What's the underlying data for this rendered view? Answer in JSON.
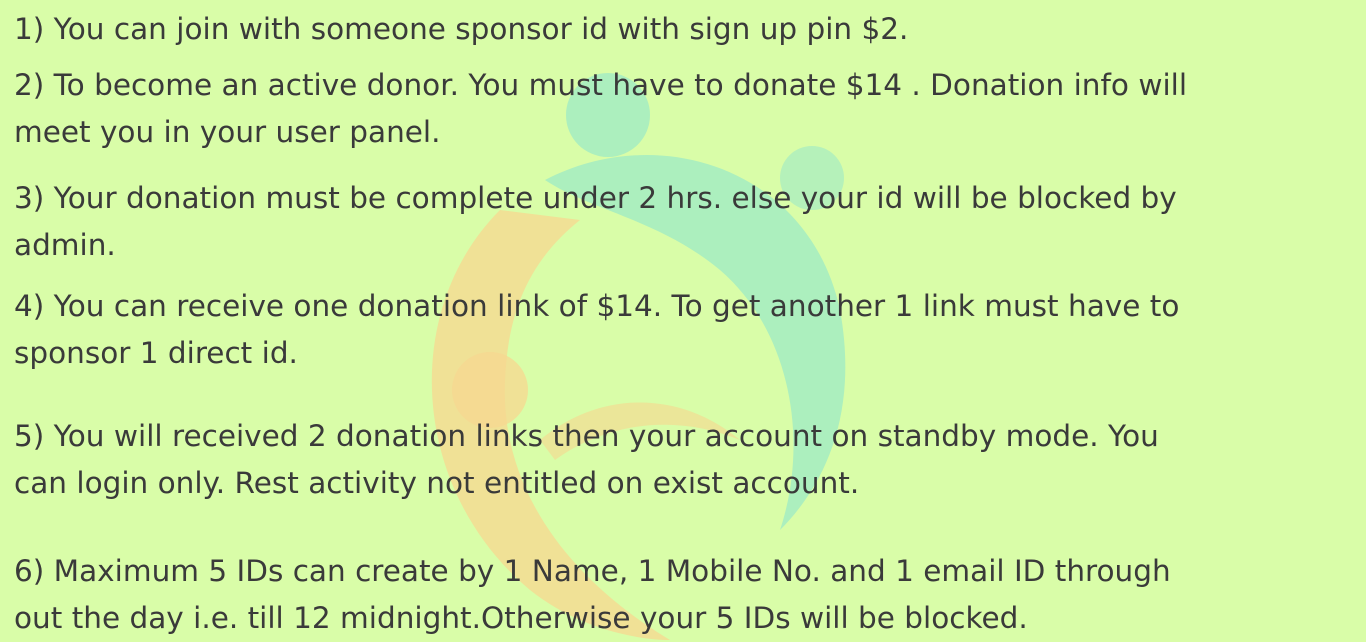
{
  "rules": [
    {
      "lines": [
        "1) You can join with someone sponsor id with sign up pin $2."
      ]
    },
    {
      "lines": [
        "2) To become an active donor. You must have to donate $14 . Donation info will",
        "meet you in your user panel."
      ]
    },
    {
      "lines": [
        "3) Your donation must be complete under 2 hrs. else your id will be blocked by",
        "admin."
      ]
    },
    {
      "lines": [
        "4) You can receive one donation link of $14. To get another 1 link must have to",
        "sponsor 1 direct id."
      ]
    },
    {
      "lines": [
        "5) You will received 2 donation links then your account on standby mode. You",
        "can login only. Rest activity not entitled on exist account."
      ]
    },
    {
      "lines": [
        "6) Maximum 5 IDs can create by  1 Name, 1 Mobile No. and 1 email ID through",
        "out the day i.e. till 12 midnight.Otherwise your 5 IDs will be blocked."
      ]
    }
  ],
  "colors": {
    "background": "#d9fda8",
    "text": "#3a3a3a",
    "watermark_teal": "#9ce9c6",
    "watermark_orange": "#f7d790"
  },
  "watermark": {
    "icon": "people-circle-logo-icon"
  }
}
